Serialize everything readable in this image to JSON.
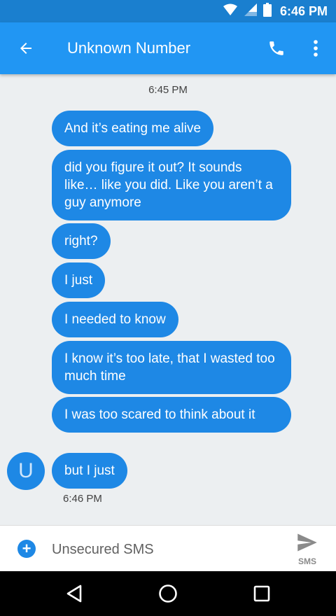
{
  "status_bar": {
    "time": "6:46 PM"
  },
  "app_bar": {
    "title": "Unknown Number"
  },
  "thread": {
    "first_timestamp": "6:45 PM",
    "messages": [
      "And it’s eating me alive",
      "did you figure it out? It sounds like… like you did. Like you aren’t a guy anymore",
      "right?",
      "I just",
      "I needed to know",
      "I know it’s too late, that I wasted too much time",
      "I was too scared to think about it",
      "but I just"
    ],
    "last_timestamp": "6:46 PM",
    "avatar_initial": "U"
  },
  "composer": {
    "placeholder": "Unsecured SMS",
    "send_label": "SMS"
  },
  "colors": {
    "status_bar": "#1a7fcf",
    "app_bar": "#2196f3",
    "bubble": "#1e88e5",
    "background": "#eceff1"
  }
}
